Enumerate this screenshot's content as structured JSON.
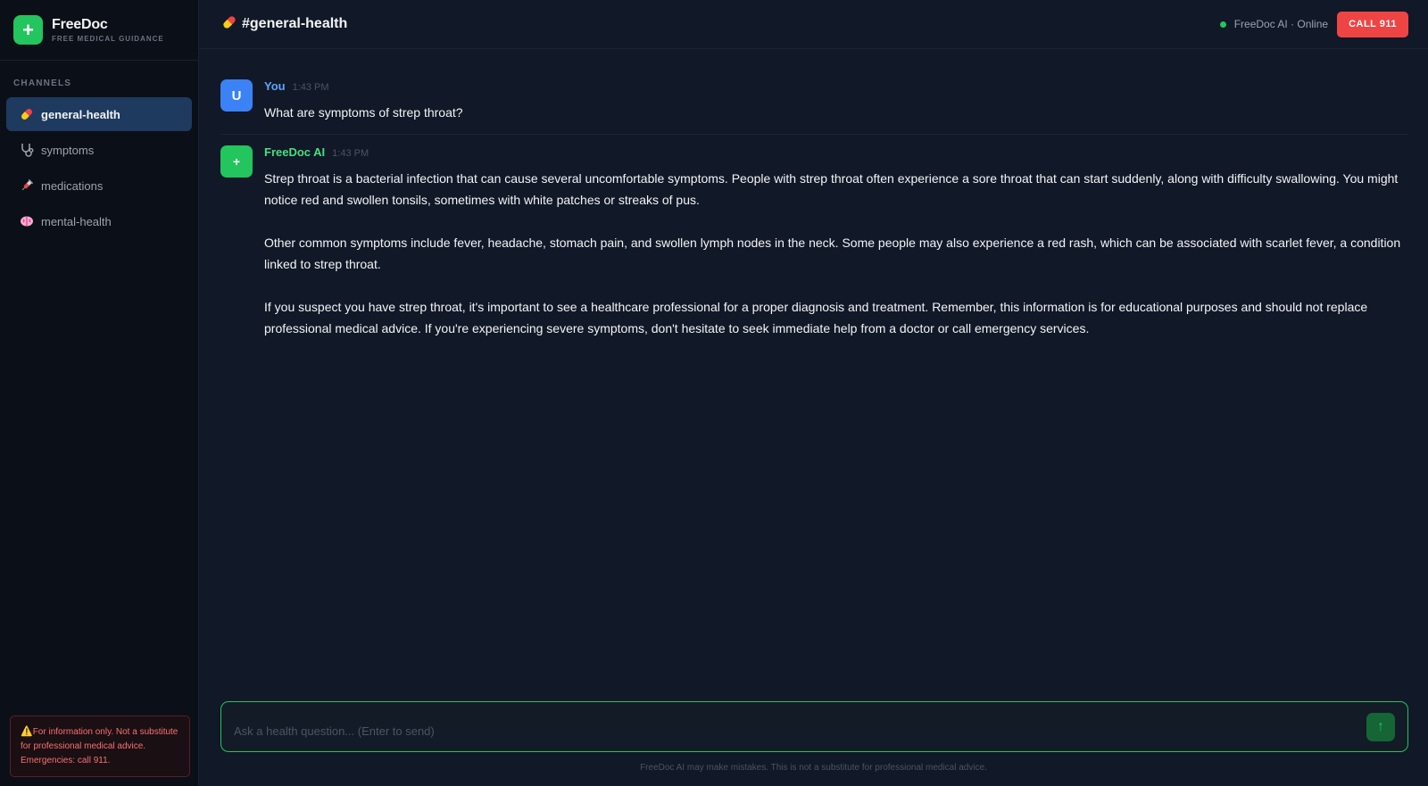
{
  "brand": {
    "name": "FreeDoc",
    "subtitle": "FREE MEDICAL GUIDANCE",
    "logo_glyph": "+"
  },
  "sidebar": {
    "section_label": "CHANNELS",
    "channels": [
      {
        "label": "general-health",
        "icon": "pill-icon",
        "active": true
      },
      {
        "label": "symptoms",
        "icon": "stethoscope-icon",
        "active": false
      },
      {
        "label": "medications",
        "icon": "syringe-icon",
        "active": false
      },
      {
        "label": "mental-health",
        "icon": "brain-icon",
        "active": false
      }
    ],
    "disclaimer": {
      "icon": "⚠️",
      "text": "For information only. Not a substitute for professional medical advice. Emergencies: call 911."
    }
  },
  "header": {
    "title": "#general-health",
    "status_text": "FreeDoc AI · Online",
    "call_button": "CALL 911"
  },
  "messages": [
    {
      "author": "You",
      "avatar": "U",
      "time": "1:43 PM",
      "paragraphs": [
        "What are symptoms of strep throat?"
      ]
    },
    {
      "author": "FreeDoc AI",
      "avatar": "+",
      "time": "1:43 PM",
      "paragraphs": [
        "Strep throat is a bacterial infection that can cause several uncomfortable symptoms. People with strep throat often experience a sore throat that can start suddenly, along with difficulty swallowing. You might notice red and swollen tonsils, sometimes with white patches or streaks of pus.",
        "Other common symptoms include fever, headache, stomach pain, and swollen lymph nodes in the neck. Some people may also experience a red rash, which can be associated with scarlet fever, a condition linked to strep throat.",
        "If you suspect you have strep throat, it's important to see a healthcare professional for a proper diagnosis and treatment. Remember, this information is for educational purposes and should not replace professional medical advice. If you're experiencing severe symptoms, don't hesitate to seek immediate help from a doctor or call emergency services."
      ]
    }
  ],
  "composer": {
    "placeholder": "Ask a health question... (Enter to send)",
    "value": "",
    "send_glyph": "↑"
  },
  "footer_note": "FreeDoc AI may make mistakes. This is not a substitute for professional medical advice.",
  "colors": {
    "accent": "#22c55e",
    "danger": "#ef4444",
    "user": "#3b82f6",
    "active_channel": "#1e3a5f"
  }
}
